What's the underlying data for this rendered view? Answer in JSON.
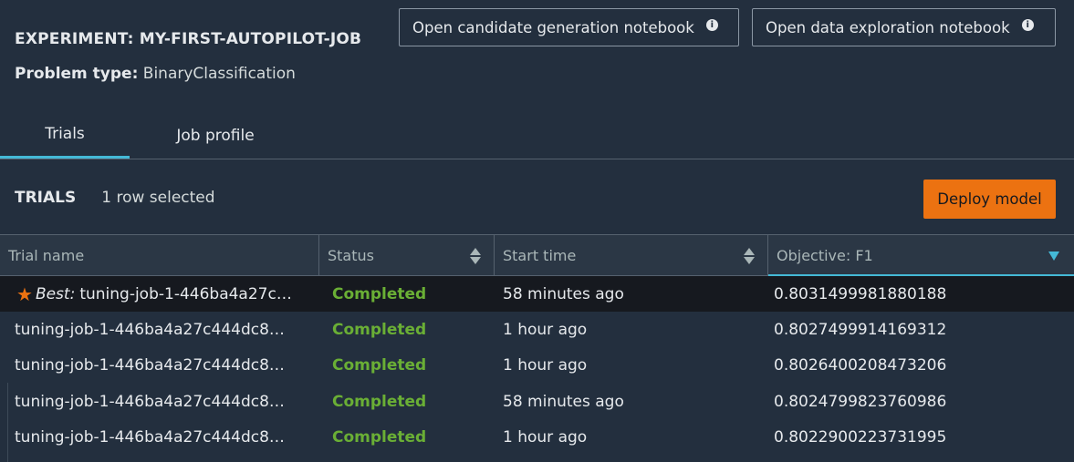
{
  "header": {
    "experiment": "EXPERIMENT: MY-FIRST-AUTOPILOT-JOB",
    "problem_label": "Problem type:",
    "problem_value": "BinaryClassification",
    "candidate_button": "Open candidate generation notebook",
    "exploration_button": "Open data exploration notebook",
    "info_glyph": "i"
  },
  "tabs": [
    {
      "label": "Trials",
      "active": true
    },
    {
      "label": "Job profile",
      "active": false
    }
  ],
  "trials": {
    "title": "TRIALS",
    "selection": "1 row selected",
    "deploy_label": "Deploy model"
  },
  "table": {
    "columns": [
      "Trial name",
      "Status",
      "Start time",
      "Objective: F1"
    ],
    "sort_column": "Objective: F1",
    "sort_direction": "descending",
    "rows": [
      {
        "best_label": "Best:",
        "name": "tuning-job-1-446ba4a27c…",
        "status": "Completed",
        "start": "58 minutes ago",
        "objective": "0.8031499981880188",
        "selected": true
      },
      {
        "name": "tuning-job-1-446ba4a27c444dc8…",
        "status": "Completed",
        "start": "1 hour ago",
        "objective": "0.8027499914169312"
      },
      {
        "name": "tuning-job-1-446ba4a27c444dc8…",
        "status": "Completed",
        "start": "1 hour ago",
        "objective": "0.8026400208473206"
      },
      {
        "name": "tuning-job-1-446ba4a27c444dc8…",
        "status": "Completed",
        "start": "58 minutes ago",
        "objective": "0.8024799823760986"
      },
      {
        "name": "tuning-job-1-446ba4a27c444dc8…",
        "status": "Completed",
        "start": "1 hour ago",
        "objective": "0.8022900223731995"
      }
    ]
  },
  "colors": {
    "background": "#232f3e",
    "accent_orange": "#ec7211",
    "status_green": "#6aaf35",
    "active_blue": "#44b9d6",
    "selected_row": "#16191f"
  },
  "icons": [
    "info-icon",
    "sort-icon",
    "sort-desc-icon",
    "star-icon"
  ]
}
